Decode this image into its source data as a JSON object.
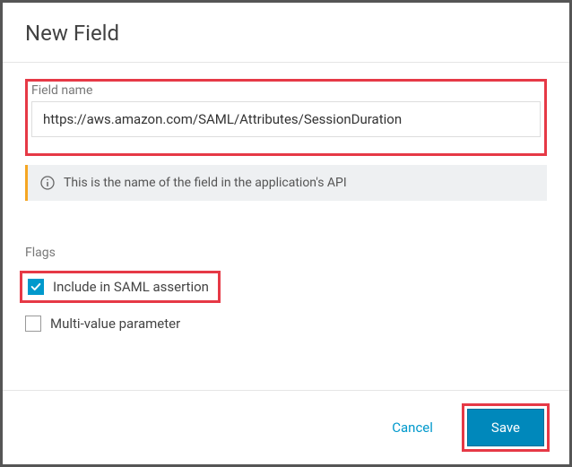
{
  "dialog": {
    "title": "New Field"
  },
  "field_name": {
    "label": "Field name",
    "value": "https://aws.amazon.com/SAML/Attributes/SessionDuration"
  },
  "info": {
    "text": "This is the name of the field in the application's API"
  },
  "flags": {
    "label": "Flags",
    "include_saml": {
      "label": "Include in SAML assertion",
      "checked": true
    },
    "multi_value": {
      "label": "Multi-value parameter",
      "checked": false
    }
  },
  "buttons": {
    "cancel": "Cancel",
    "save": "Save"
  }
}
